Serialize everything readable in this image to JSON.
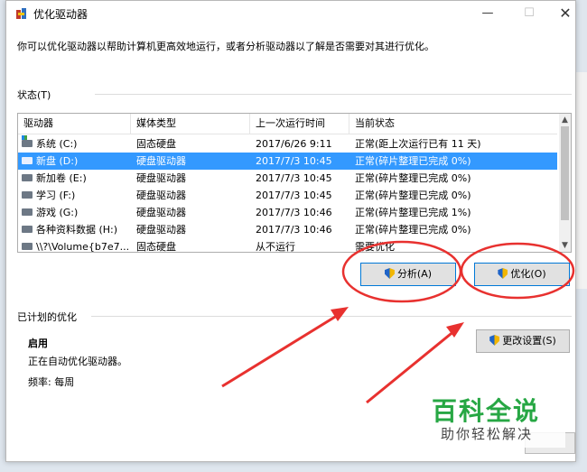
{
  "window": {
    "title": "优化驱动器",
    "minimize": "—",
    "maximize": "☐",
    "close": "✕"
  },
  "description": "你可以优化驱动器以帮助计算机更高效地运行，或者分析驱动器以了解是否需要对其进行优化。",
  "status_group_label": "状态(T)",
  "columns": [
    "驱动器",
    "媒体类型",
    "上一次运行时间",
    "当前状态"
  ],
  "drives": [
    {
      "name": "系统 (C:)",
      "media": "固态硬盘",
      "last_run": "2017/6/26 9:11",
      "status": "正常(距上次运行已有 11 天)",
      "icon": "system-drive-icon"
    },
    {
      "name": "新盘 (D:)",
      "media": "硬盘驱动器",
      "last_run": "2017/7/3 10:45",
      "status": "正常(碎片整理已完成 0%)",
      "icon": "drive-icon",
      "selected": true
    },
    {
      "name": "新加卷 (E:)",
      "media": "硬盘驱动器",
      "last_run": "2017/7/3 10:45",
      "status": "正常(碎片整理已完成 0%)",
      "icon": "drive-icon"
    },
    {
      "name": "学习 (F:)",
      "media": "硬盘驱动器",
      "last_run": "2017/7/3 10:45",
      "status": "正常(碎片整理已完成 0%)",
      "icon": "drive-icon"
    },
    {
      "name": "游戏 (G:)",
      "media": "硬盘驱动器",
      "last_run": "2017/7/3 10:46",
      "status": "正常(碎片整理已完成 1%)",
      "icon": "drive-icon"
    },
    {
      "name": "各种资料数据 (H:)",
      "media": "硬盘驱动器",
      "last_run": "2017/7/3 10:46",
      "status": "正常(碎片整理已完成 0%)",
      "icon": "drive-icon"
    },
    {
      "name": "\\\\?\\Volume{b7e7...",
      "media": "固态硬盘",
      "last_run": "从不运行",
      "status": "需要优化",
      "icon": "drive-icon"
    }
  ],
  "buttons": {
    "analyze": "分析(A)",
    "optimize": "优化(O)",
    "change_settings": "更改设置(S)"
  },
  "scheduled": {
    "group_label": "已计划的优化",
    "state": "启用",
    "line1": "正在自动优化驱动器。",
    "line2": "频率: 每周"
  },
  "watermark": {
    "main": "百科全说",
    "sub": "助你轻松解决"
  },
  "colors": {
    "selection": "#3399ff",
    "annotation_red": "#e8312f",
    "watermark_green": "#27a744"
  }
}
